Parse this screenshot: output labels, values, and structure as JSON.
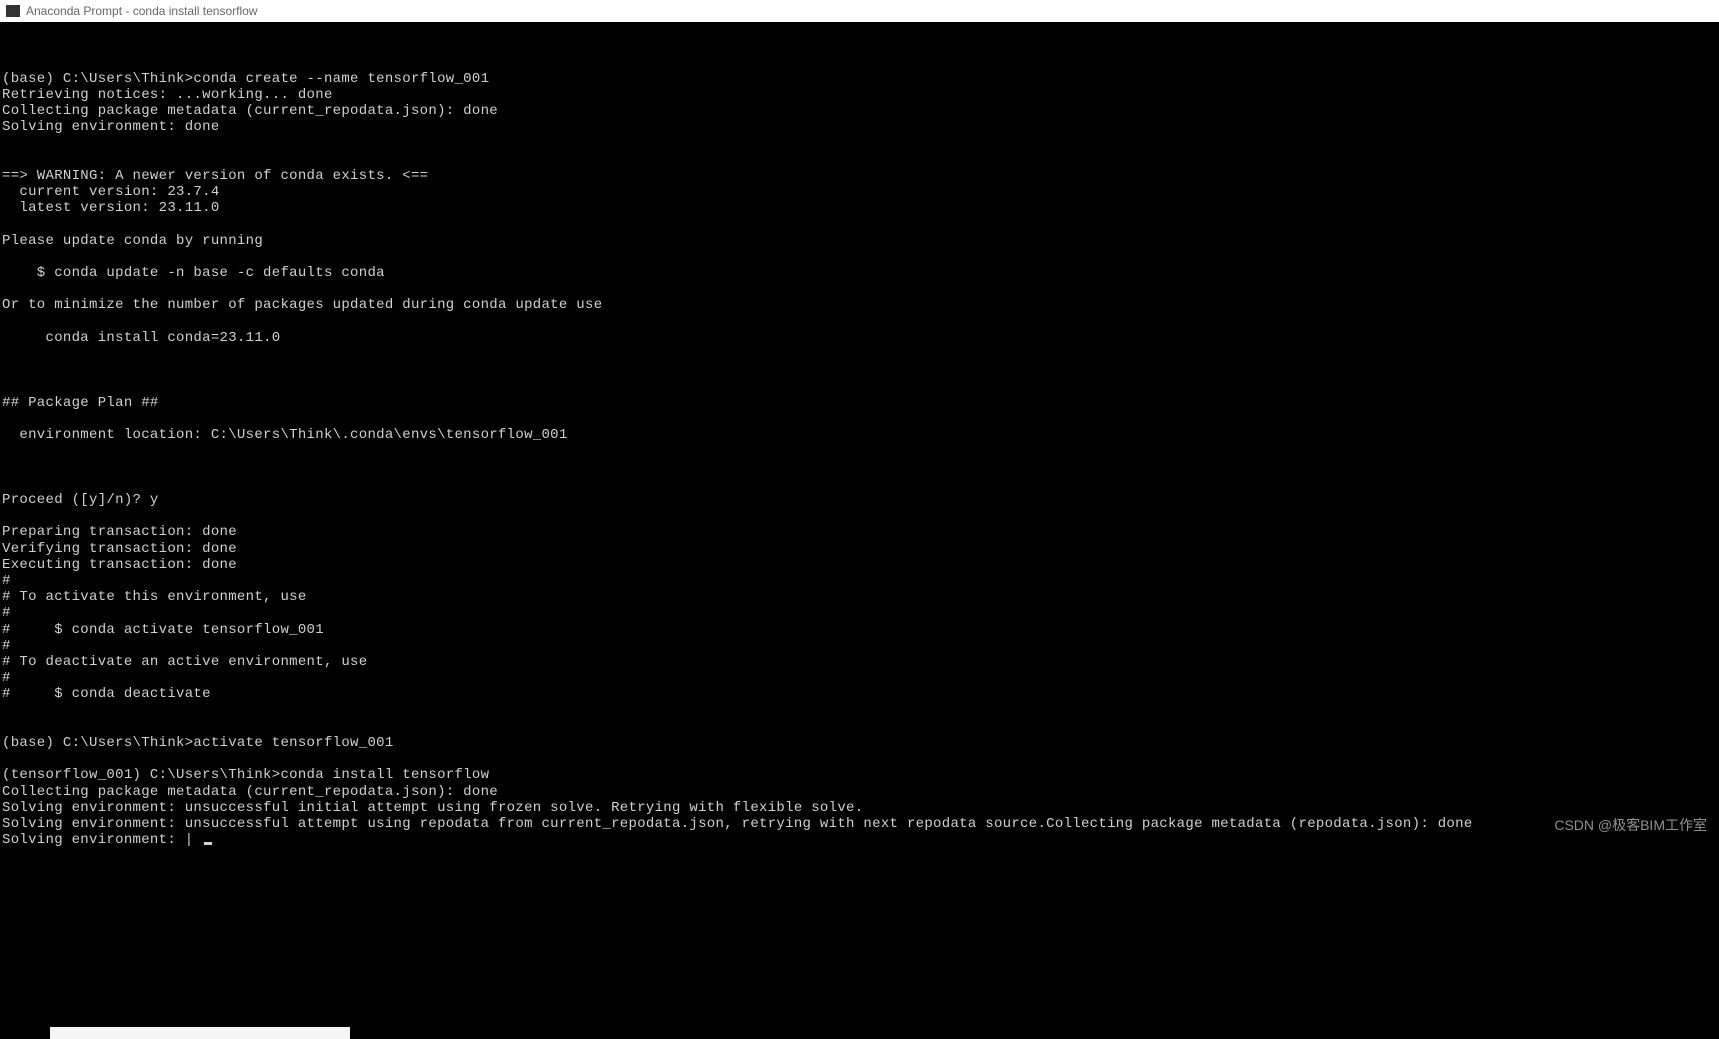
{
  "window": {
    "title": "Anaconda Prompt - conda  install tensorflow"
  },
  "terminal": {
    "lines": [
      "",
      "(base) C:\\Users\\Think>conda create --name tensorflow_001",
      "Retrieving notices: ...working... done",
      "Collecting package metadata (current_repodata.json): done",
      "Solving environment: done",
      "",
      "",
      "==> WARNING: A newer version of conda exists. <==",
      "  current version: 23.7.4",
      "  latest version: 23.11.0",
      "",
      "Please update conda by running",
      "",
      "    $ conda update -n base -c defaults conda",
      "",
      "Or to minimize the number of packages updated during conda update use",
      "",
      "     conda install conda=23.11.0",
      "",
      "",
      "",
      "## Package Plan ##",
      "",
      "  environment location: C:\\Users\\Think\\.conda\\envs\\tensorflow_001",
      "",
      "",
      "",
      "Proceed ([y]/n)? y",
      "",
      "Preparing transaction: done",
      "Verifying transaction: done",
      "Executing transaction: done",
      "#",
      "# To activate this environment, use",
      "#",
      "#     $ conda activate tensorflow_001",
      "#",
      "# To deactivate an active environment, use",
      "#",
      "#     $ conda deactivate",
      "",
      "",
      "(base) C:\\Users\\Think>activate tensorflow_001",
      "",
      "(tensorflow_001) C:\\Users\\Think>conda install tensorflow",
      "Collecting package metadata (current_repodata.json): done",
      "Solving environment: unsuccessful initial attempt using frozen solve. Retrying with flexible solve.",
      "Solving environment: unsuccessful attempt using repodata from current_repodata.json, retrying with next repodata source.Collecting package metadata (repodata.json): done",
      "Solving environment: | "
    ]
  },
  "watermark": "CSDN @极客BIM工作室"
}
